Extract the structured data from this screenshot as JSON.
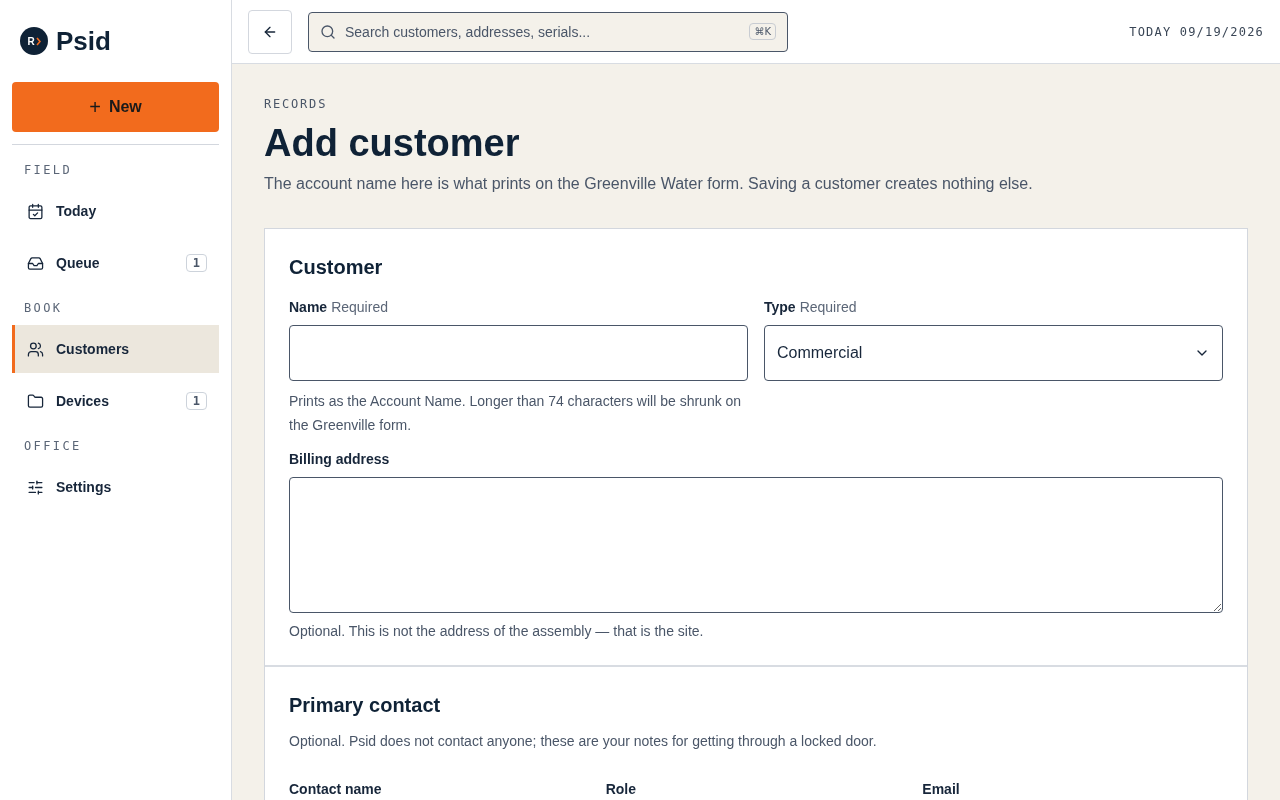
{
  "sidebar": {
    "logo": {
      "mark": "R",
      "name": "Psid"
    },
    "new_button": {
      "icon": "+",
      "label": "New"
    },
    "sections": [
      {
        "title": "FIELD",
        "items": [
          {
            "kind": "calendar",
            "label": "Today",
            "selected": false
          },
          {
            "kind": "inbox",
            "label": "Queue",
            "count": "1",
            "selected": false
          }
        ]
      },
      {
        "title": "BOOK",
        "items": [
          {
            "kind": "users",
            "label": "Customers",
            "selected": true
          },
          {
            "kind": "folder",
            "label": "Devices",
            "count": "1",
            "selected": false
          }
        ]
      },
      {
        "title": "OFFICE",
        "items": [
          {
            "kind": "sliders",
            "label": "Settings",
            "selected": false
          }
        ]
      }
    ]
  },
  "topbar": {
    "search": {
      "placeholder": "Search customers, addresses, serials...",
      "shortcut": "⌘K"
    },
    "date": "TODAY 09/19/2026"
  },
  "page": {
    "eyebrow": "RECORDS",
    "title": "Add customer",
    "subtitle": "The account name here is what prints on the Greenville Water form. Saving a customer creates nothing else."
  },
  "customer": {
    "title": "Customer",
    "name": {
      "label": "Name",
      "required": "Required",
      "help": "Prints as the Account Name. Longer than 74 characters will be shrunk on the Greenville form."
    },
    "type": {
      "label": "Type",
      "required": "Required",
      "value": "Commercial"
    },
    "billing": {
      "label": "Billing address",
      "help": "Optional. This is not the address of the assembly — that is the site."
    }
  },
  "contact": {
    "title": "Primary contact",
    "help": "Optional. Psid does not contact anyone; these are your notes for getting through a locked door.",
    "fields": [
      "Contact name",
      "Role",
      "Email"
    ]
  }
}
